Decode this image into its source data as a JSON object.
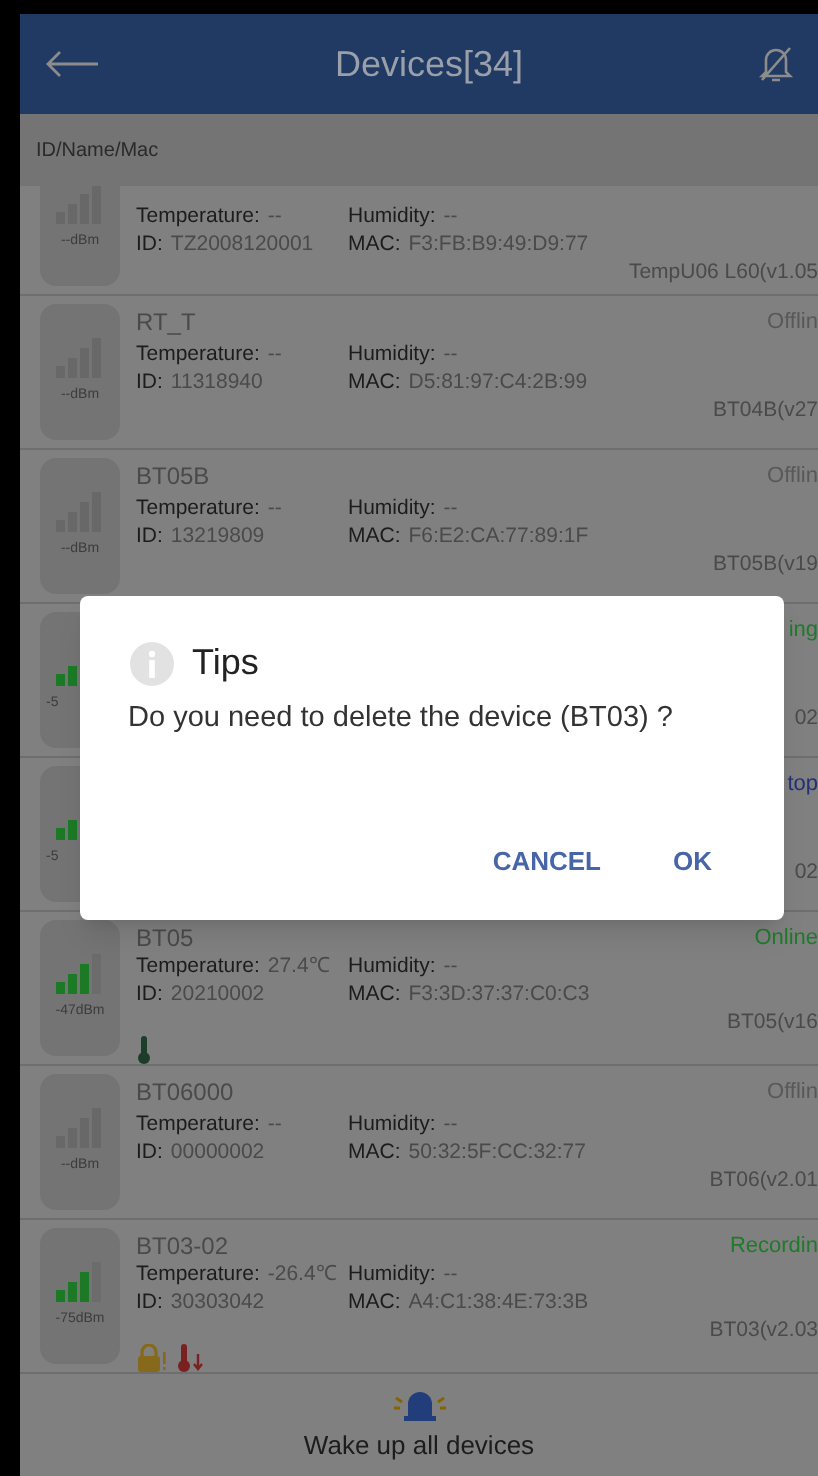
{
  "header": {
    "title": "Devices[34]"
  },
  "search": {
    "placeholder": "ID/Name/Mac"
  },
  "devices": [
    {
      "signal_active": false,
      "dbm": "--dBm",
      "temperature_label": "Temperature:",
      "temperature": "--",
      "id_label": "ID:",
      "id": "TZ2008120001",
      "humidity_label": "Humidity:",
      "humidity": "--",
      "mac_label": "MAC:",
      "mac": "F3:FB:B9:49:D9:77",
      "version": "TempU06 L60(v1.05"
    },
    {
      "name": "RT_T",
      "status": "Offlin",
      "color": "#585858",
      "signal_active": false,
      "dbm": "--dBm",
      "temperature_label": "Temperature:",
      "temperature": "--",
      "id_label": "ID:",
      "id": "11318940",
      "humidity_label": "Humidity:",
      "humidity": "--",
      "mac_label": "MAC:",
      "mac": "D5:81:97:C4:2B:99",
      "version": "BT04B(v27"
    },
    {
      "name": "BT05B",
      "status": "Offlin",
      "color": "#585858",
      "signal_active": false,
      "dbm": "--dBm",
      "temperature_label": "Temperature:",
      "temperature": "--",
      "id_label": "ID:",
      "id": "13219809",
      "humidity_label": "Humidity:",
      "humidity": "--",
      "mac_label": "MAC:",
      "mac": "F6:E2:CA:77:89:1F",
      "version": "BT05B(v19"
    },
    {
      "status": "ing",
      "color": "#1f7a2a",
      "signal_active": true,
      "dbm": "-5",
      "version": "02"
    },
    {
      "status": "top",
      "color": "#22307a",
      "signal_active": true,
      "dbm": "-5",
      "version": "02"
    },
    {
      "name": "BT05",
      "status": "Online",
      "color": "#1f7a2a",
      "signal_active": true,
      "dbm": "-47dBm",
      "temperature_label": "Temperature:",
      "temperature": "27.4℃",
      "id_label": "ID:",
      "id": "20210002",
      "humidity_label": "Humidity:",
      "humidity": "--",
      "mac_label": "MAC:",
      "mac": "F3:3D:37:37:C0:C3",
      "version": "BT05(v16",
      "alerts": [
        {
          "kind": "thermometer"
        }
      ]
    },
    {
      "name": "BT06000",
      "status": "Offlin",
      "color": "#585858",
      "signal_active": false,
      "dbm": "--dBm",
      "temperature_label": "Temperature:",
      "temperature": "--",
      "id_label": "ID:",
      "id": "00000002",
      "humidity_label": "Humidity:",
      "humidity": "--",
      "mac_label": "MAC:",
      "mac": "50:32:5F:CC:32:77",
      "version": "BT06(v2.01"
    },
    {
      "name": "BT03-02",
      "status": "Recordin",
      "color": "#1f7a2a",
      "signal_active": true,
      "dbm": "-75dBm",
      "temperature_label": "Temperature:",
      "temperature": "-26.4℃",
      "id_label": "ID:",
      "id": "30303042",
      "humidity_label": "Humidity:",
      "humidity": "--",
      "mac_label": "MAC:",
      "mac": "A4:C1:38:4E:73:3B",
      "version": "BT03(v2.03",
      "alerts": [
        {
          "kind": "lock-alert"
        },
        {
          "kind": "thermometer-low"
        }
      ]
    }
  ],
  "footer": {
    "label": "Wake up all devices"
  },
  "dialog": {
    "title": "Tips",
    "message": "Do you need to delete the device (BT03) ?",
    "buttons": [
      "CANCEL",
      "OK"
    ]
  }
}
